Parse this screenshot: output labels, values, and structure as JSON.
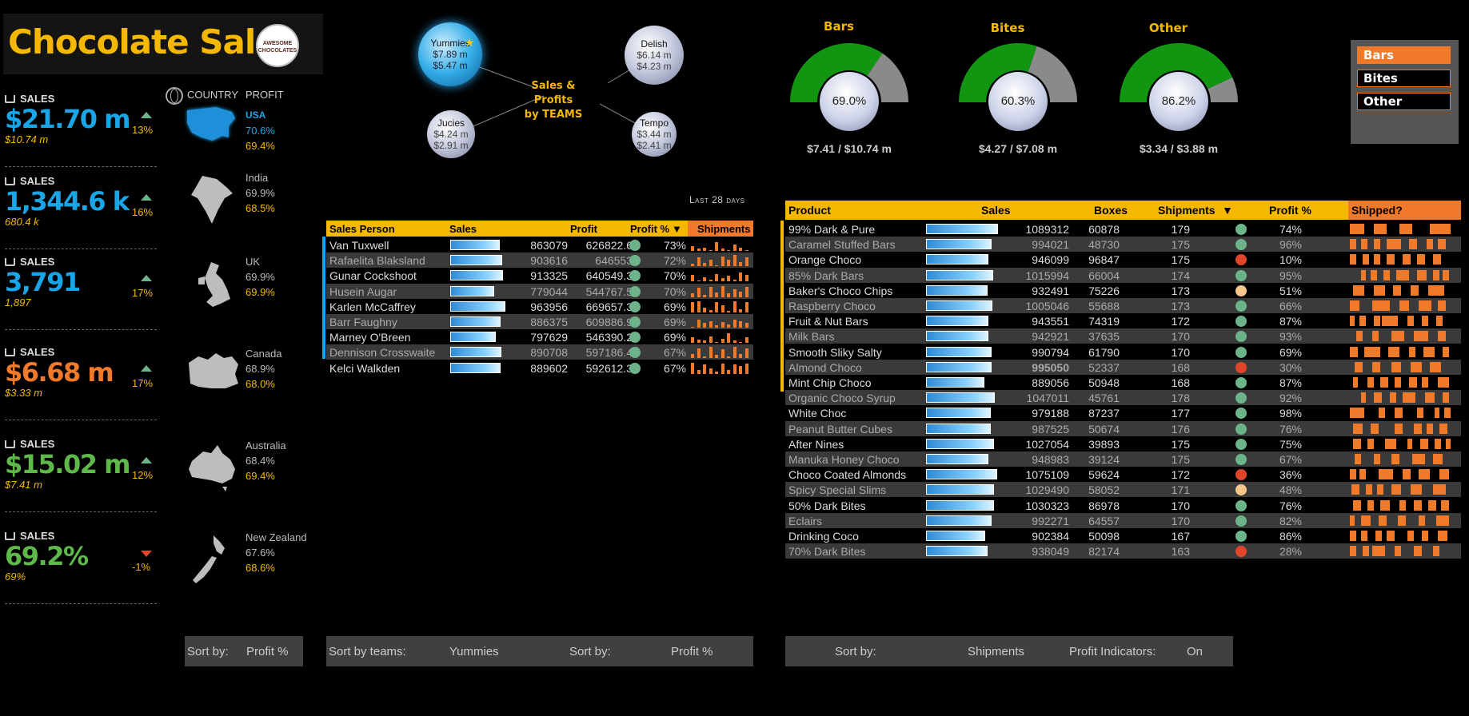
{
  "header": {
    "title": "Chocolate Sales",
    "logo_text": "AWESOME CHOCOLATES"
  },
  "kpis": [
    {
      "label": "SALES",
      "value": "$21.70 m",
      "sub": "$10.74 m",
      "change": "13%",
      "direction": "up",
      "color": "#1aa5e6"
    },
    {
      "label": "SALES",
      "value": "1,344.6 k",
      "sub": "680.4 k",
      "change": "16%",
      "direction": "up",
      "color": "#1aa5e6"
    },
    {
      "label": "SALES",
      "value": "3,791",
      "sub": "1,897",
      "change": "17%",
      "direction": "up",
      "color": "#1aa5e6"
    },
    {
      "label": "SALES",
      "value": "$6.68 m",
      "sub": "$3.33 m",
      "change": "17%",
      "direction": "up",
      "color": "#f07a2a"
    },
    {
      "label": "SALES",
      "value": "$15.02 m",
      "sub": "$7.41 m",
      "change": "12%",
      "direction": "up",
      "color": "#5fb84a"
    },
    {
      "label": "SALES",
      "value": "69.2%",
      "sub": "69%",
      "change": "-1%",
      "direction": "down",
      "color": "#5fb84a"
    }
  ],
  "countries_header": {
    "country": "COUNTRY",
    "profit": "PROFIT",
    "icon": "globe-icon"
  },
  "countries": [
    {
      "name": "USA",
      "sales_pct": "70.6%",
      "profit_pct": "69.4%",
      "selected": true
    },
    {
      "name": "India",
      "sales_pct": "69.9%",
      "profit_pct": "68.5%"
    },
    {
      "name": "UK",
      "sales_pct": "69.9%",
      "profit_pct": "69.9%"
    },
    {
      "name": "Canada",
      "sales_pct": "68.9%",
      "profit_pct": "68.0%"
    },
    {
      "name": "Australia",
      "sales_pct": "68.4%",
      "profit_pct": "69.4%"
    },
    {
      "name": "New Zealand",
      "sales_pct": "67.6%",
      "profit_pct": "68.6%"
    }
  ],
  "teams": {
    "center_label": "Sales & Profits by TEAMS",
    "center_line1": "Sales & Profits",
    "center_line2": "by TEAMS",
    "items": [
      {
        "name": "Yummies",
        "sales": "$7.89 m",
        "profit": "$5.47 m",
        "selected": true
      },
      {
        "name": "Delish",
        "sales": "$6.14 m",
        "profit": "$4.23 m"
      },
      {
        "name": "Jucies",
        "sales": "$4.24 m",
        "profit": "$2.91 m"
      },
      {
        "name": "Tempo",
        "sales": "$3.44 m",
        "profit": "$2.41 m"
      }
    ]
  },
  "period_label": "Last 28 days",
  "salespeople": {
    "headers": [
      "Sales Person",
      "Sales",
      "Profit",
      "Profit %",
      "Shipments"
    ],
    "sort_arrow": "▼",
    "rows": [
      {
        "name": "Van Tuxwell",
        "sales": "863079",
        "profit": "626822.6",
        "pct": "73%",
        "bar": 0.86,
        "spark": [
          4,
          2,
          3,
          1,
          8,
          2,
          1,
          6,
          3,
          1
        ]
      },
      {
        "name": "Rafaelita Blaksland",
        "sales": "903616",
        "profit": "646553",
        "pct": "72%",
        "bar": 0.9,
        "spark": [
          2,
          8,
          3,
          6,
          1,
          9,
          6,
          10,
          4,
          8
        ]
      },
      {
        "name": "Gunar Cockshoot",
        "sales": "913325",
        "profit": "640549.3",
        "pct": "70%",
        "bar": 0.91,
        "spark": [
          6,
          1,
          4,
          2,
          7,
          3,
          5,
          2,
          8,
          6
        ]
      },
      {
        "name": "Husein Augar",
        "sales": "779044",
        "profit": "544767.5",
        "pct": "70%",
        "bar": 0.77,
        "spark": [
          3,
          8,
          2,
          9,
          4,
          10,
          3,
          7,
          5,
          9
        ]
      },
      {
        "name": "Karlen McCaffrey",
        "sales": "963956",
        "profit": "669657.3",
        "pct": "69%",
        "bar": 0.96,
        "spark": [
          9,
          10,
          4,
          2,
          9,
          6,
          1,
          10,
          3,
          9
        ]
      },
      {
        "name": "Barr Faughny",
        "sales": "886375",
        "profit": "609886.9",
        "pct": "69%",
        "bar": 0.88,
        "spark": [
          1,
          7,
          4,
          6,
          2,
          5,
          3,
          7,
          6,
          4
        ]
      },
      {
        "name": "Marney O'Breen",
        "sales": "797629",
        "profit": "546390.2",
        "pct": "69%",
        "bar": 0.79,
        "spark": [
          5,
          3,
          2,
          6,
          1,
          4,
          9,
          2,
          1,
          5
        ]
      },
      {
        "name": "Dennison Crosswaite",
        "sales": "890708",
        "profit": "597186.4",
        "pct": "67%",
        "bar": 0.89,
        "spark": [
          4,
          9,
          2,
          10,
          3,
          8,
          2,
          10,
          4,
          9
        ]
      },
      {
        "name": "Kelci Walkden",
        "sales": "889602",
        "profit": "592612.3",
        "pct": "67%",
        "bar": 0.88,
        "spark": [
          10,
          3,
          8,
          5,
          2,
          9,
          3,
          8,
          7,
          9
        ]
      }
    ]
  },
  "gauges": [
    {
      "title": "Bars",
      "value": 0.69,
      "label": "69.0%",
      "foot": "$7.41 / $10.74 m"
    },
    {
      "title": "Bites",
      "value": 0.603,
      "label": "60.3%",
      "foot": "$4.27 / $7.08 m"
    },
    {
      "title": "Other",
      "value": 0.862,
      "label": "86.2%",
      "foot": "$3.34 / $3.88 m"
    }
  ],
  "slicer": {
    "items": [
      {
        "label": "Bars",
        "selected": true
      },
      {
        "label": "Bites"
      },
      {
        "label": "Other"
      }
    ]
  },
  "products": {
    "headers": [
      "Product",
      "Sales",
      "Boxes",
      "Shipments",
      "Profit %",
      "Shipped?"
    ],
    "sort_arrow": "▼",
    "rows": [
      {
        "name": "99% Dark & Pure",
        "sales": "1089312",
        "boxes": "60878",
        "ship": "179",
        "pct": "74%",
        "dot": "green",
        "bar": 0.9,
        "hl": true
      },
      {
        "name": "Caramel Stuffed Bars",
        "sales": "994021",
        "boxes": "48730",
        "ship": "175",
        "pct": "96%",
        "dot": "green",
        "bar": 0.82,
        "hl": true
      },
      {
        "name": "Orange Choco",
        "sales": "946099",
        "boxes": "96847",
        "ship": "175",
        "pct": "10%",
        "dot": "red",
        "bar": 0.78,
        "hl": true
      },
      {
        "name": "85% Dark Bars",
        "sales": "1015994",
        "boxes": "66004",
        "ship": "174",
        "pct": "95%",
        "dot": "green",
        "bar": 0.84,
        "hl": true
      },
      {
        "name": "Baker's Choco Chips",
        "sales": "932491",
        "boxes": "75226",
        "ship": "173",
        "pct": "51%",
        "dot": "yellow",
        "bar": 0.77,
        "hl": true
      },
      {
        "name": "Raspberry Choco",
        "sales": "1005046",
        "boxes": "55688",
        "ship": "173",
        "pct": "66%",
        "dot": "green",
        "bar": 0.83,
        "hl": true
      },
      {
        "name": "Fruit & Nut Bars",
        "sales": "943551",
        "boxes": "74319",
        "ship": "172",
        "pct": "87%",
        "dot": "green",
        "bar": 0.78,
        "hl": true
      },
      {
        "name": "Milk Bars",
        "sales": "942921",
        "boxes": "37635",
        "ship": "170",
        "pct": "93%",
        "dot": "green",
        "bar": 0.78,
        "hl": true
      },
      {
        "name": "Smooth Sliky Salty",
        "sales": "990794",
        "boxes": "61790",
        "ship": "170",
        "pct": "69%",
        "dot": "green",
        "bar": 0.82,
        "hl": true
      },
      {
        "name": "Almond Choco",
        "sales": "995050",
        "boxes": "52337",
        "ship": "168",
        "pct": "30%",
        "dot": "red",
        "bar": 0.82,
        "hl": true,
        "bold": true
      },
      {
        "name": "Mint Chip Choco",
        "sales": "889056",
        "boxes": "50948",
        "ship": "168",
        "pct": "87%",
        "dot": "green",
        "bar": 0.73,
        "hl": true
      },
      {
        "name": "Organic Choco Syrup",
        "sales": "1047011",
        "boxes": "45761",
        "ship": "178",
        "pct": "92%",
        "dot": "green",
        "bar": 0.86
      },
      {
        "name": "White Choc",
        "sales": "979188",
        "boxes": "87237",
        "ship": "177",
        "pct": "98%",
        "dot": "green",
        "bar": 0.81
      },
      {
        "name": "Peanut Butter Cubes",
        "sales": "987525",
        "boxes": "50674",
        "ship": "176",
        "pct": "76%",
        "dot": "green",
        "bar": 0.81
      },
      {
        "name": "After Nines",
        "sales": "1027054",
        "boxes": "39893",
        "ship": "175",
        "pct": "75%",
        "dot": "green",
        "bar": 0.85
      },
      {
        "name": "Manuka Honey Choco",
        "sales": "948983",
        "boxes": "39124",
        "ship": "175",
        "pct": "67%",
        "dot": "green",
        "bar": 0.78
      },
      {
        "name": "Choco Coated Almonds",
        "sales": "1075109",
        "boxes": "59624",
        "ship": "172",
        "pct": "36%",
        "dot": "red",
        "bar": 0.89
      },
      {
        "name": "Spicy Special Slims",
        "sales": "1029490",
        "boxes": "58052",
        "ship": "171",
        "pct": "48%",
        "dot": "yellow",
        "bar": 0.85
      },
      {
        "name": "50% Dark Bites",
        "sales": "1030323",
        "boxes": "86978",
        "ship": "170",
        "pct": "76%",
        "dot": "green",
        "bar": 0.85
      },
      {
        "name": "Eclairs",
        "sales": "992271",
        "boxes": "64557",
        "ship": "170",
        "pct": "82%",
        "dot": "green",
        "bar": 0.82
      },
      {
        "name": "Drinking Coco",
        "sales": "902384",
        "boxes": "50098",
        "ship": "167",
        "pct": "86%",
        "dot": "green",
        "bar": 0.74
      },
      {
        "name": "70% Dark Bites",
        "sales": "938049",
        "boxes": "82174",
        "ship": "163",
        "pct": "28%",
        "dot": "red",
        "bar": 0.77
      }
    ]
  },
  "sort_controls": {
    "left": {
      "label": "Sort by:",
      "value": "Profit %"
    },
    "middle": {
      "teams_label": "Sort by teams:",
      "teams_value": "Yummies",
      "label": "Sort by:",
      "value": "Profit %"
    },
    "right": {
      "label": "Sort by:",
      "value": "Shipments",
      "indicators_label": "Profit Indicators:",
      "indicators_value": "On"
    }
  },
  "colors": {
    "accent": "#f5b800",
    "orange": "#f07a2a",
    "blue": "#1aa5e6",
    "green": "#5fb84a",
    "gauge_fill": "#129612",
    "gauge_rest": "#8a8a8a"
  }
}
